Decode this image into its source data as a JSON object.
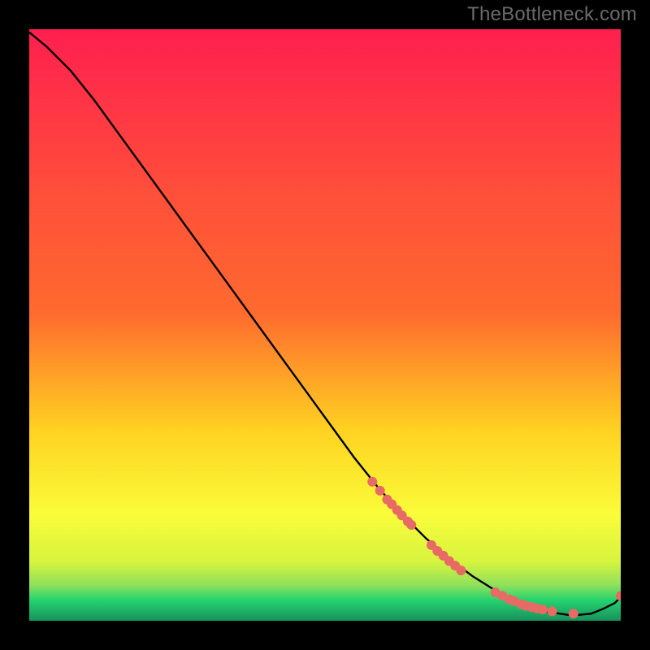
{
  "watermark": "TheBottleneck.com",
  "colors": {
    "gradient_top": "#ff1f4f",
    "gradient_mid1": "#ff6a2e",
    "gradient_mid2": "#ffd321",
    "gradient_mid3": "#fafc3a",
    "gradient_green": "#25d36f",
    "curve": "#000000",
    "marker": "#e86a64",
    "background": "#000000"
  },
  "chart_data": {
    "type": "line",
    "title": "",
    "xlabel": "",
    "ylabel": "",
    "xlim": [
      0.0,
      1.0
    ],
    "ylim": [
      0.0,
      1.0
    ],
    "legend": false,
    "grid": false,
    "curve_x": [
      0.0,
      0.03,
      0.07,
      0.11,
      0.15,
      0.19,
      0.23,
      0.27,
      0.31,
      0.35,
      0.39,
      0.43,
      0.47,
      0.51,
      0.55,
      0.59,
      0.63,
      0.67,
      0.71,
      0.75,
      0.79,
      0.83,
      0.87,
      0.91,
      0.93,
      0.95,
      0.97,
      0.99,
      1.0
    ],
    "curve_y": [
      0.995,
      0.97,
      0.93,
      0.88,
      0.825,
      0.77,
      0.715,
      0.66,
      0.605,
      0.55,
      0.495,
      0.44,
      0.385,
      0.33,
      0.275,
      0.225,
      0.18,
      0.14,
      0.105,
      0.075,
      0.05,
      0.03,
      0.016,
      0.01,
      0.01,
      0.012,
      0.02,
      0.03,
      0.04
    ],
    "markers": [
      {
        "x": 0.58,
        "y": 0.235
      },
      {
        "x": 0.593,
        "y": 0.22
      },
      {
        "x": 0.605,
        "y": 0.205
      },
      {
        "x": 0.613,
        "y": 0.197
      },
      {
        "x": 0.622,
        "y": 0.187
      },
      {
        "x": 0.63,
        "y": 0.178
      },
      {
        "x": 0.64,
        "y": 0.168
      },
      {
        "x": 0.646,
        "y": 0.162
      },
      {
        "x": 0.68,
        "y": 0.128
      },
      {
        "x": 0.69,
        "y": 0.118
      },
      {
        "x": 0.7,
        "y": 0.11
      },
      {
        "x": 0.71,
        "y": 0.101
      },
      {
        "x": 0.72,
        "y": 0.093
      },
      {
        "x": 0.73,
        "y": 0.085
      },
      {
        "x": 0.788,
        "y": 0.048
      },
      {
        "x": 0.8,
        "y": 0.042
      },
      {
        "x": 0.812,
        "y": 0.036
      },
      {
        "x": 0.82,
        "y": 0.033
      },
      {
        "x": 0.832,
        "y": 0.028
      },
      {
        "x": 0.84,
        "y": 0.025
      },
      {
        "x": 0.85,
        "y": 0.023
      },
      {
        "x": 0.858,
        "y": 0.021
      },
      {
        "x": 0.868,
        "y": 0.019
      },
      {
        "x": 0.884,
        "y": 0.016
      },
      {
        "x": 0.92,
        "y": 0.012
      },
      {
        "x": 1.0,
        "y": 0.042
      }
    ],
    "note": "x and y are fractions of the plot area width/height; the plot area itself carries no numeric axes in the source image, so values are normalized."
  }
}
